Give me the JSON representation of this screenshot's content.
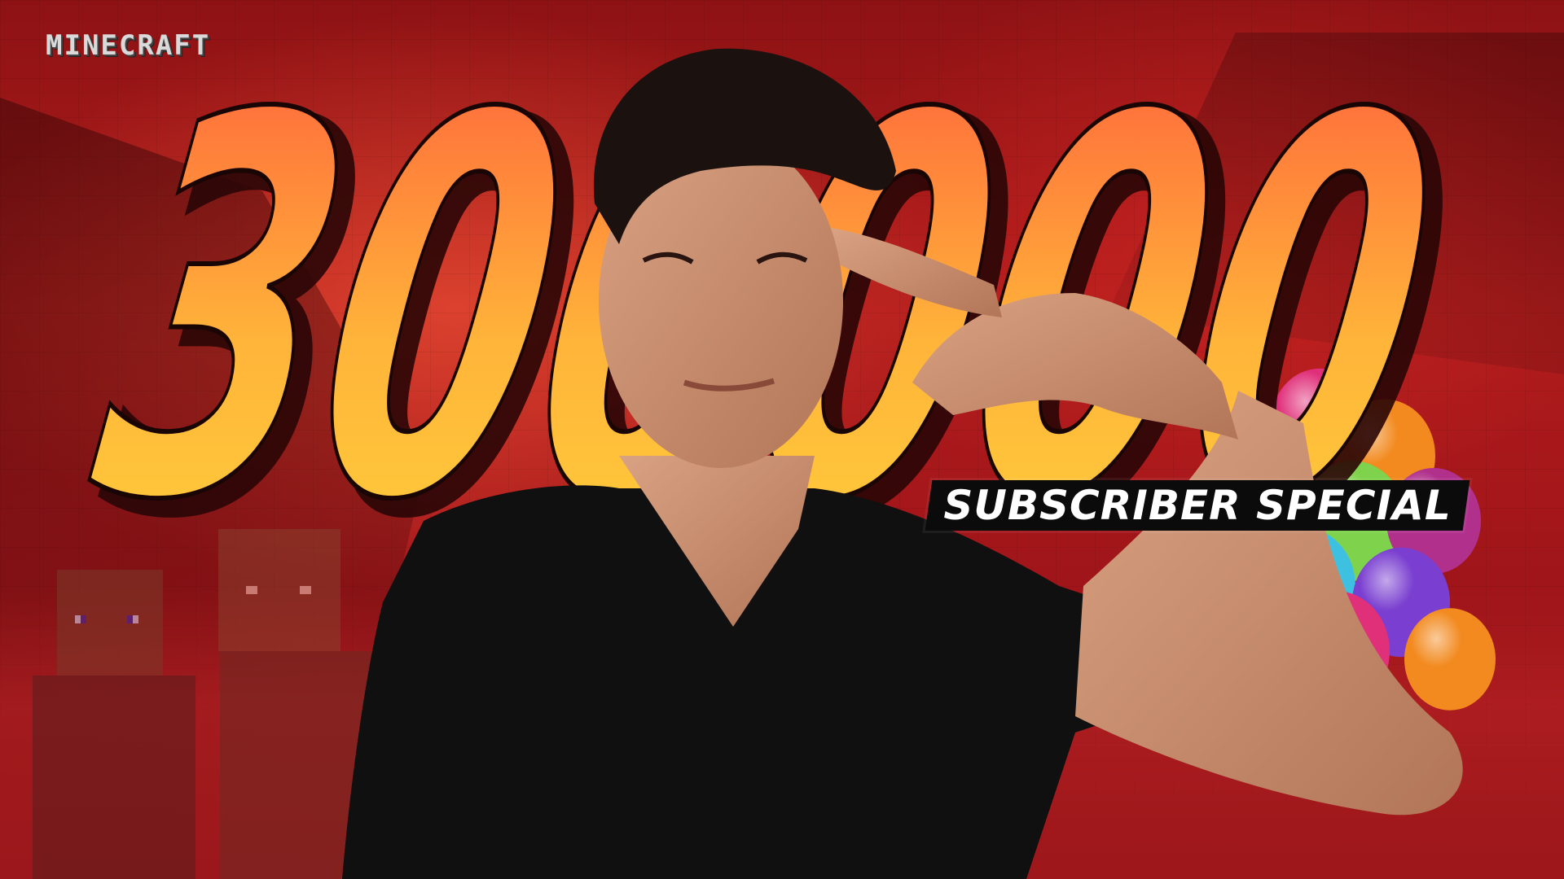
{
  "logo": {
    "text": "MINECRAFT"
  },
  "headline": {
    "number": "300000"
  },
  "badge": {
    "text": "SUBSCRIBER SPECIAL"
  },
  "colors": {
    "background_red": "#a3161a",
    "number_top": "#ff5a3c",
    "number_bottom": "#ffd23a",
    "number_outline": "#1a0505",
    "badge_bg": "#0b0b0b",
    "badge_text": "#ffffff",
    "shirt": "#101010",
    "skin": "#c98f6e",
    "hair": "#1b1210"
  },
  "balloon_colors": [
    "#e0307a",
    "#f28a1f",
    "#2bb3c8",
    "#7fd24b",
    "#b0308c",
    "#f05a4c",
    "#3ec1e0",
    "#7a3fd0"
  ]
}
